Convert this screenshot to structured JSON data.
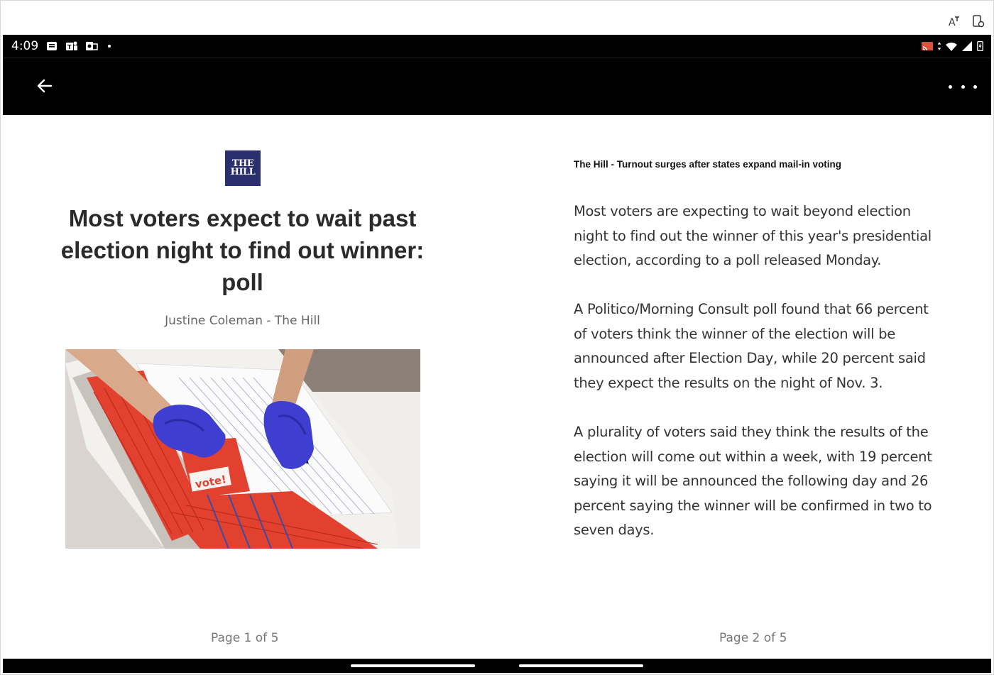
{
  "status_bar": {
    "time": "4:09"
  },
  "app_bar": {
    "back_icon": "arrow-left-icon",
    "more_icon": "more-horizontal-icon"
  },
  "left_page": {
    "publisher_logo_text": [
      "THE",
      "HILL"
    ],
    "headline": "Most voters expect to wait past election night to find out winner: poll",
    "byline": "Justine Coleman - The Hill",
    "image_caption_text": "vote!",
    "page_label": "Page 1 of 5"
  },
  "right_page": {
    "kicker": "The Hill - Turnout surges after states expand mail-in voting",
    "paragraphs": [
      "Most voters are expecting to wait beyond election night to find out the winner of this year's presidential election, according to a poll released Monday.",
      "A Politico/Morning Consult poll found that 66 percent of voters think the winner of the election will be announced after Election Day, while 20 percent said they expect the results on the night of Nov. 3.",
      "A plurality of voters said they think the results of the election will come out within a week, with 19 percent saying it will be announced the following day and 26 percent saying the winner will be confirmed in two to seven days."
    ],
    "page_label": "Page 2 of 5"
  },
  "colors": {
    "app_bar": "#000000",
    "logo_bg": "#2a2f6e",
    "headline": "#2a2a2a",
    "body_text": "#333333",
    "muted_text": "#777777"
  }
}
